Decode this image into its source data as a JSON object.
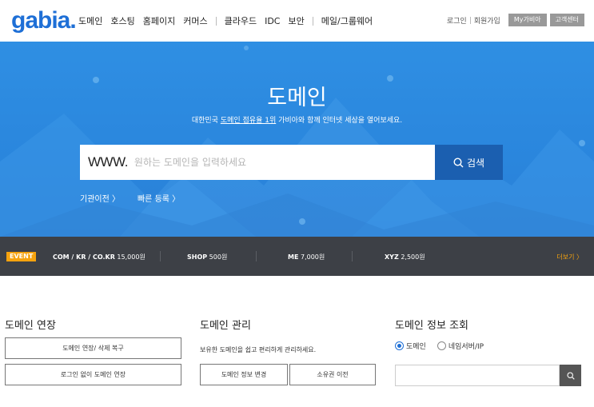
{
  "header": {
    "logo": "gabia",
    "nav": [
      "도메인",
      "호스팅",
      "홈페이지",
      "커머스",
      "클라우드",
      "IDC",
      "보안",
      "메일/그룹웨어"
    ],
    "login": "로그인",
    "signup": "회원가입",
    "my_gabia": "My가비아",
    "support": "고객센터"
  },
  "hero": {
    "title": "도메인",
    "subtitle_pre": "대한민국 ",
    "subtitle_link": "도메인 점유율 1위",
    "subtitle_post": " 가비아와 함께 인터넷 세상을 열어보세요.",
    "www_prefix": "WWW.",
    "search_placeholder": "원하는 도메인을 입력하세요",
    "search_button": "검색",
    "link_transfer": "기관이전  〉",
    "link_quick": "빠른 등록  〉"
  },
  "event": {
    "badge": "EVENT",
    "items": [
      {
        "name": "COM / KR / CO.KR",
        "price": "15,000원"
      },
      {
        "name": "SHOP",
        "price": "500원"
      },
      {
        "name": "ME",
        "price": "7,000원"
      },
      {
        "name": "XYZ",
        "price": "2,500원"
      }
    ],
    "more": "더보기  〉"
  },
  "renew": {
    "title": "도메인 연장",
    "btn_renew_restore": "도메인 연장/ 삭제 복구",
    "btn_renew_nologin": "로그인 없이 도메인 연장"
  },
  "manage": {
    "title": "도메인 관리",
    "desc": "보유한 도메인을 쉽고 편리하게 관리하세요.",
    "btn_info_change": "도메인 정보 변경",
    "btn_owner_transfer": "소유권 이전"
  },
  "lookup": {
    "title": "도메인 정보 조회",
    "radio_domain": "도메인",
    "radio_nameserver": "네임서버/IP"
  },
  "colors": {
    "brand": "#1e6fd6",
    "hero_bg": "#2a86dd",
    "search_btn": "#1b5fb0",
    "event_bar": "#3d4046",
    "event_accent": "#f5a20e"
  }
}
